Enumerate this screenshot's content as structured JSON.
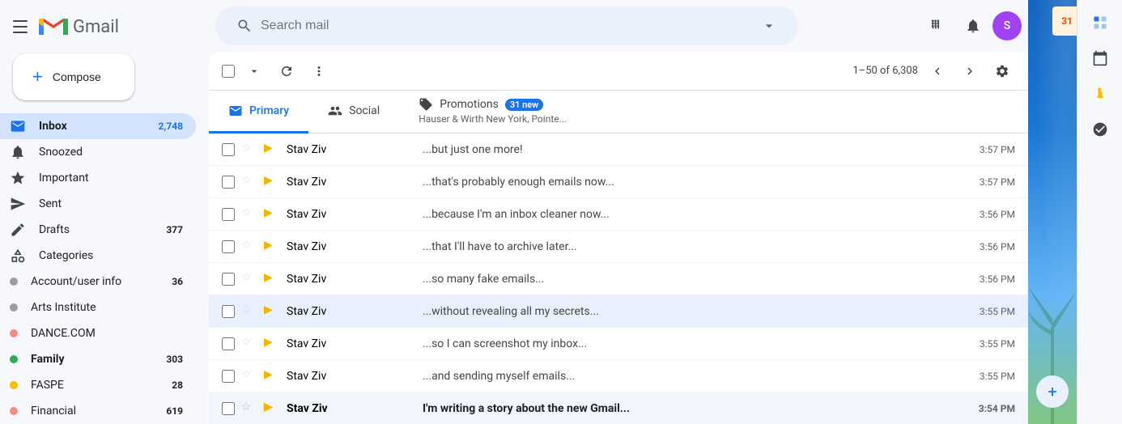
{
  "app": {
    "title": "Gmail",
    "logo_m_colors": [
      "#EA4335",
      "#4285F4",
      "#FBBC05",
      "#34A853"
    ]
  },
  "header": {
    "search_placeholder": "Search mail",
    "hamburger_label": "Main menu"
  },
  "compose": {
    "label": "Compose",
    "plus_symbol": "+"
  },
  "nav": {
    "items": [
      {
        "id": "inbox",
        "label": "Inbox",
        "count": "2,748",
        "active": true,
        "icon": "inbox"
      },
      {
        "id": "snoozed",
        "label": "Snoozed",
        "count": "",
        "active": false,
        "icon": "snoozed"
      },
      {
        "id": "important",
        "label": "Important",
        "count": "",
        "active": false,
        "icon": "important"
      },
      {
        "id": "sent",
        "label": "Sent",
        "count": "",
        "active": false,
        "icon": "sent"
      },
      {
        "id": "drafts",
        "label": "Drafts",
        "count": "377",
        "active": false,
        "icon": "drafts"
      },
      {
        "id": "categories",
        "label": "Categories",
        "count": "",
        "active": false,
        "icon": "categories"
      },
      {
        "id": "account-user-info",
        "label": "Account/user info",
        "count": "36",
        "active": false,
        "icon": "account"
      },
      {
        "id": "arts-institute",
        "label": "Arts Institute",
        "count": "",
        "active": false,
        "icon": "arts"
      },
      {
        "id": "dance-com",
        "label": "DANCE.COM",
        "count": "",
        "active": false,
        "icon": "dance"
      },
      {
        "id": "family",
        "label": "Family",
        "count": "303",
        "active": false,
        "icon": "family"
      },
      {
        "id": "faspe",
        "label": "FASPE",
        "count": "28",
        "active": false,
        "icon": "faspe"
      },
      {
        "id": "financial",
        "label": "Financial",
        "count": "619",
        "active": false,
        "icon": "financial"
      }
    ]
  },
  "toolbar": {
    "select_label": "Select",
    "refresh_label": "Refresh",
    "more_label": "More",
    "pagination": "1–50 of 6,308",
    "settings_label": "Settings"
  },
  "tabs": [
    {
      "id": "primary",
      "label": "Primary",
      "active": true,
      "badge": ""
    },
    {
      "id": "social",
      "label": "Social",
      "active": false,
      "badge": ""
    },
    {
      "id": "promotions",
      "label": "Promotions",
      "active": false,
      "badge": "31 new",
      "preview": "Hauser & Wirth New York, Pointe..."
    }
  ],
  "emails": [
    {
      "id": 1,
      "sender": "Stav Ziv",
      "subject": "...but just one more!",
      "time": "3:57 PM",
      "unread": false,
      "highlighted": false
    },
    {
      "id": 2,
      "sender": "Stav Ziv",
      "subject": "...that's probably enough emails now...",
      "time": "3:57 PM",
      "unread": false,
      "highlighted": false
    },
    {
      "id": 3,
      "sender": "Stav Ziv",
      "subject": "...because I'm an inbox cleaner now...",
      "time": "3:56 PM",
      "unread": false,
      "highlighted": false
    },
    {
      "id": 4,
      "sender": "Stav Ziv",
      "subject": "...that I'll have to archive later...",
      "time": "3:56 PM",
      "unread": false,
      "highlighted": false
    },
    {
      "id": 5,
      "sender": "Stav Ziv",
      "subject": "...so many fake emails...",
      "time": "3:56 PM",
      "unread": false,
      "highlighted": false
    },
    {
      "id": 6,
      "sender": "Stav Ziv",
      "subject": "...without revealing all my secrets...",
      "time": "3:55 PM",
      "unread": false,
      "highlighted": true
    },
    {
      "id": 7,
      "sender": "Stav Ziv",
      "subject": "...so I can screenshot my inbox...",
      "time": "3:55 PM",
      "unread": false,
      "highlighted": false
    },
    {
      "id": 8,
      "sender": "Stav Ziv",
      "subject": "...and sending myself emails...",
      "time": "3:55 PM",
      "unread": false,
      "highlighted": false
    },
    {
      "id": 9,
      "sender": "Stav Ziv",
      "subject": "I'm writing a story about the new Gmail...",
      "time": "3:54 PM",
      "unread": true,
      "highlighted": false
    }
  ],
  "calendar": {
    "day": "31"
  },
  "dot_colors": {
    "account_user_info": "#9e9e9e",
    "arts_institute": "#9e9e9e",
    "dance_com": "#f28b82",
    "family": "#34a853",
    "faspe": "#fbbc04",
    "financial": "#f28b82"
  }
}
